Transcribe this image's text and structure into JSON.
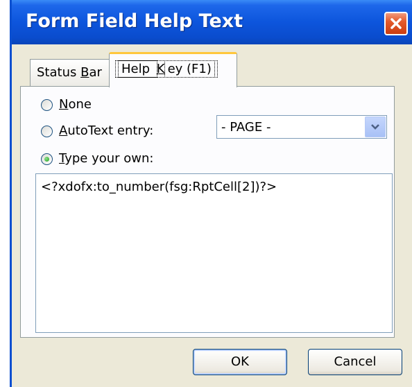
{
  "window": {
    "title": "Form Field Help Text"
  },
  "tabs": [
    {
      "label_pre": "Status ",
      "label_key": "B",
      "label_post": "ar"
    },
    {
      "label_pre": "Help ",
      "label_key": "K",
      "label_post": "ey (F1)"
    }
  ],
  "options": {
    "none": {
      "label_key": "N",
      "label_post": "one",
      "selected": false
    },
    "autotext": {
      "label_key": "A",
      "label_post": "utoText entry:",
      "selected": false
    },
    "type_own": {
      "label_key": "T",
      "label_post": "ype your own:",
      "selected": true
    }
  },
  "autotext_select": {
    "value": "- PAGE -"
  },
  "help_text": {
    "value": "<?xdofx:to_number(fsg:RptCell[2])?>"
  },
  "buttons": {
    "ok": "OK",
    "cancel": "Cancel"
  },
  "icons": {
    "close": "close-icon",
    "dropdown": "chevron-down-icon"
  },
  "colors": {
    "titlebar": "#0a4ccd",
    "dialog_bg": "#ece9d8",
    "active_tab_accent": "#ffc73c",
    "close_button": "#e35a2c"
  }
}
